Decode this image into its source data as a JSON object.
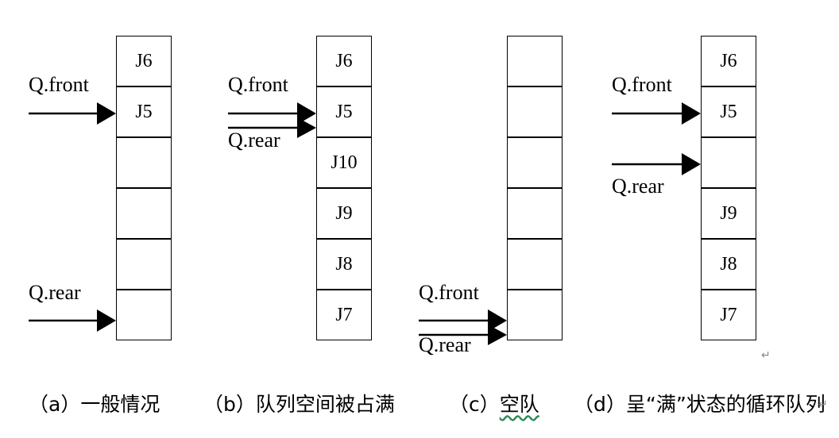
{
  "diagrams": [
    {
      "cells": [
        "J6",
        "J5",
        "",
        "",
        "",
        ""
      ],
      "pointers": [
        {
          "label": "Q.front"
        },
        {
          "label": "Q.rear"
        }
      ],
      "caption": "（a）一般情况"
    },
    {
      "cells": [
        "J6",
        "J5",
        "J10",
        "J9",
        "J8",
        "J7"
      ],
      "pointers": [
        {
          "label": "Q.front"
        },
        {
          "label": "Q.rear"
        }
      ],
      "caption": "（b）队列空间被占满"
    },
    {
      "cells": [
        "",
        "",
        "",
        "",
        "",
        ""
      ],
      "pointers": [
        {
          "label": "Q.front"
        },
        {
          "label": "Q.rear"
        }
      ],
      "caption_prefix": "（c）",
      "caption_main": "空队"
    },
    {
      "cells": [
        "J6",
        "J5",
        "",
        "J9",
        "J8",
        "J7"
      ],
      "pointers": [
        {
          "label": "Q.front"
        },
        {
          "label": "Q.rear"
        }
      ],
      "caption": "（d）呈“满”状态的循环队列"
    }
  ],
  "marks": {
    "paragraph": "↵"
  }
}
